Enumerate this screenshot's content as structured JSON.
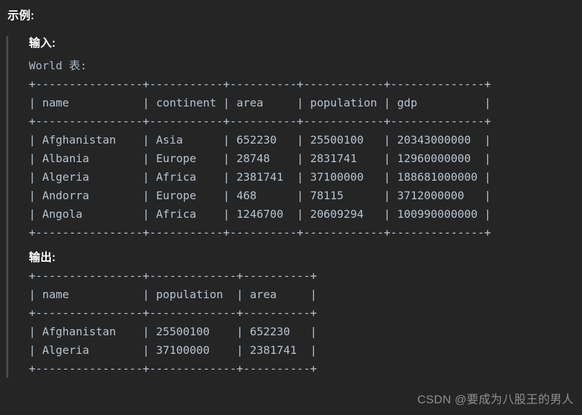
{
  "heading": "示例:",
  "input_section": {
    "label": "输入:",
    "caption": "World 表:",
    "table": {
      "columns": [
        "name",
        "continent",
        "area",
        "population",
        "gdp"
      ],
      "widths": [
        16,
        11,
        10,
        12,
        14
      ],
      "rows": [
        [
          "Afghanistan",
          "Asia",
          "652230",
          "25500100",
          "20343000000"
        ],
        [
          "Albania",
          "Europe",
          "28748",
          "2831741",
          "12960000000"
        ],
        [
          "Algeria",
          "Africa",
          "2381741",
          "37100000",
          "188681000000"
        ],
        [
          "Andorra",
          "Europe",
          "468",
          "78115",
          "3712000000"
        ],
        [
          "Angola",
          "Africa",
          "1246700",
          "20609294",
          "100990000000"
        ]
      ]
    }
  },
  "output_section": {
    "label": "输出:",
    "table": {
      "columns": [
        "name",
        "population",
        "area"
      ],
      "widths": [
        16,
        13,
        10
      ],
      "rows": [
        [
          "Afghanistan",
          "25500100",
          "652230"
        ],
        [
          "Algeria",
          "37100000",
          "2381741"
        ]
      ]
    }
  },
  "watermark": "CSDN @要成为八股王的男人",
  "colors": {
    "background": "#252526",
    "text": "#b8c4cf",
    "heading": "#ffffff",
    "muted": "#a9b7c6",
    "quote_border": "#4a4a4a",
    "watermark": "#8f8f8f"
  }
}
